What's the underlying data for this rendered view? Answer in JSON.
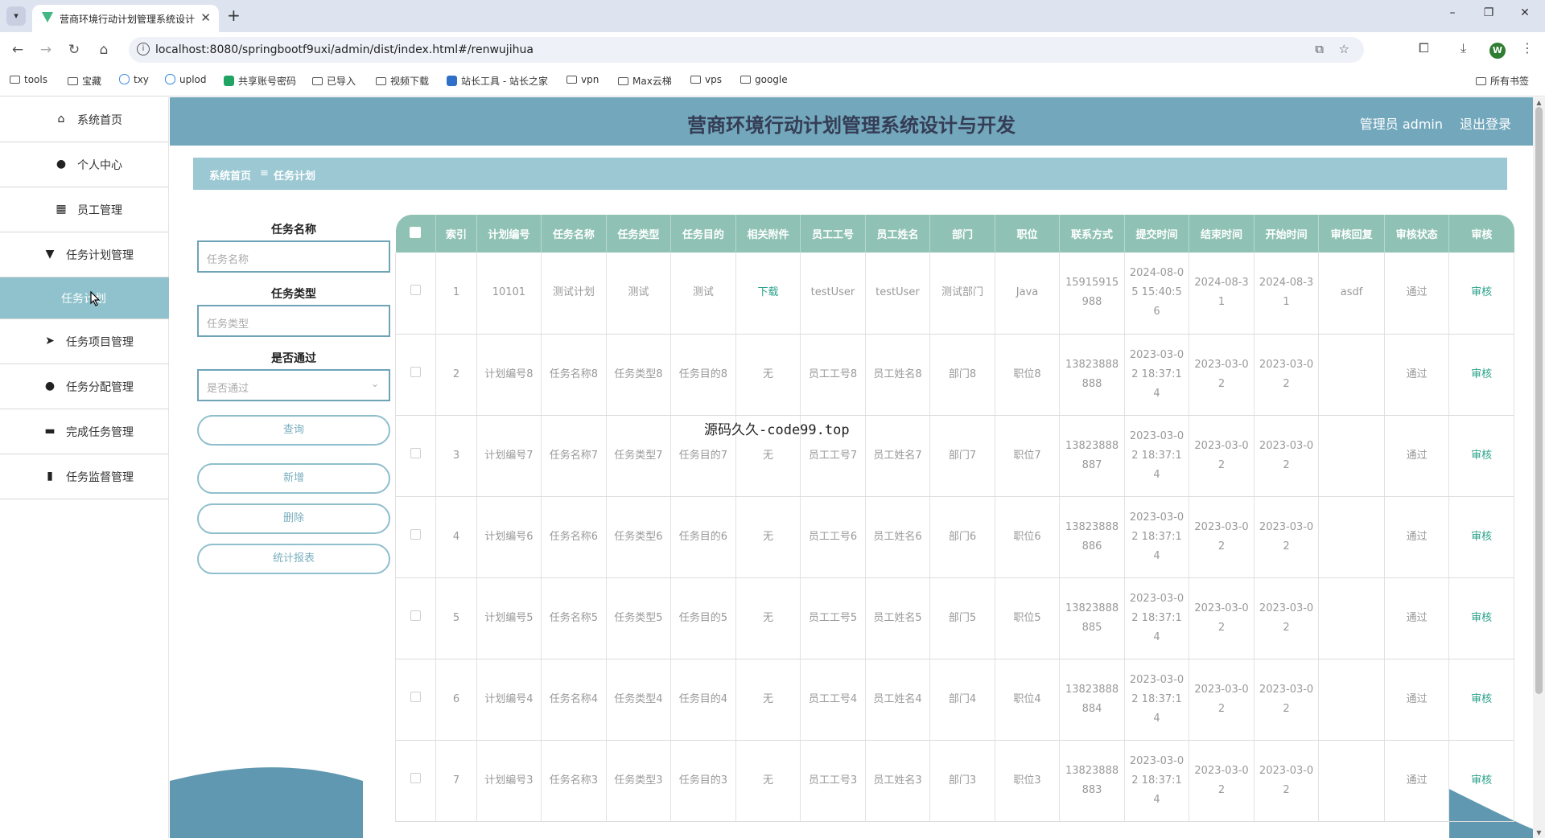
{
  "browser": {
    "tab_title": "营商环境行动计划管理系统设计",
    "url": "localhost:8080/springbootf9uxi/admin/dist/index.html#/renwujihua",
    "profile_initial": "W",
    "bookmarks": [
      "tools",
      "宝藏",
      "txy",
      "uplod",
      "共享账号密码",
      "已导入",
      "视频下载",
      "站长工具 - 站长之家",
      "vpn",
      "Max云梯",
      "vps",
      "google"
    ],
    "all_bookmarks": "所有书签"
  },
  "app": {
    "title": "营商环境行动计划管理系统设计与开发",
    "user_label": "管理员 admin",
    "logout_label": "退出登录"
  },
  "sidebar": {
    "items": [
      {
        "label": "系统首页",
        "icon": "home-icon"
      },
      {
        "label": "个人中心",
        "icon": "user-icon"
      },
      {
        "label": "员工管理",
        "icon": "grid-icon"
      },
      {
        "label": "任务计划管理",
        "icon": "podium-icon"
      },
      {
        "label": "任务计划",
        "icon": ""
      },
      {
        "label": "任务项目管理",
        "icon": "send-icon"
      },
      {
        "label": "任务分配管理",
        "icon": "bulb-icon"
      },
      {
        "label": "完成任务管理",
        "icon": "briefcase-icon"
      },
      {
        "label": "任务监督管理",
        "icon": "bar-chart-icon"
      }
    ]
  },
  "breadcrumb": {
    "home": "系统首页",
    "separator": "≡",
    "current": "任务计划"
  },
  "search": {
    "name_label": "任务名称",
    "name_placeholder": "任务名称",
    "type_label": "任务类型",
    "type_placeholder": "任务类型",
    "pass_label": "是否通过",
    "pass_placeholder": "是否通过",
    "query_button": "查询",
    "add_button": "新增",
    "delete_button": "删除",
    "report_button": "统计报表"
  },
  "table": {
    "columns": [
      "",
      "索引",
      "计划编号",
      "任务名称",
      "任务类型",
      "任务目的",
      "相关附件",
      "员工工号",
      "员工姓名",
      "部门",
      "职位",
      "联系方式",
      "提交时间",
      "结束时间",
      "开始时间",
      "审核回复",
      "审核状态",
      "审核"
    ],
    "rows": [
      {
        "index": "1",
        "plan_no": "10101",
        "name": "测试计划",
        "type": "测试",
        "purpose": "测试",
        "attachment": "下载",
        "emp_no": "testUser",
        "emp_name": "testUser",
        "dept": "测试部门",
        "position": "Java",
        "phone": "15915915988",
        "submit_time": "2024-08-05 15:40:56",
        "end_time": "2024-08-31",
        "start_time": "2024-08-31",
        "reply": "asdf",
        "status": "通过",
        "action": "审核"
      },
      {
        "index": "2",
        "plan_no": "计划编号8",
        "name": "任务名称8",
        "type": "任务类型8",
        "purpose": "任务目的8",
        "attachment": "无",
        "emp_no": "员工工号8",
        "emp_name": "员工姓名8",
        "dept": "部门8",
        "position": "职位8",
        "phone": "13823888888",
        "submit_time": "2023-03-02 18:37:14",
        "end_time": "2023-03-02",
        "start_time": "2023-03-02",
        "reply": "",
        "status": "通过",
        "action": "审核"
      },
      {
        "index": "3",
        "plan_no": "计划编号7",
        "name": "任务名称7",
        "type": "任务类型7",
        "purpose": "任务目的7",
        "attachment": "无",
        "emp_no": "员工工号7",
        "emp_name": "员工姓名7",
        "dept": "部门7",
        "position": "职位7",
        "phone": "13823888887",
        "submit_time": "2023-03-02 18:37:14",
        "end_time": "2023-03-02",
        "start_time": "2023-03-02",
        "reply": "",
        "status": "通过",
        "action": "审核"
      },
      {
        "index": "4",
        "plan_no": "计划编号6",
        "name": "任务名称6",
        "type": "任务类型6",
        "purpose": "任务目的6",
        "attachment": "无",
        "emp_no": "员工工号6",
        "emp_name": "员工姓名6",
        "dept": "部门6",
        "position": "职位6",
        "phone": "13823888886",
        "submit_time": "2023-03-02 18:37:14",
        "end_time": "2023-03-02",
        "start_time": "2023-03-02",
        "reply": "",
        "status": "通过",
        "action": "审核"
      },
      {
        "index": "5",
        "plan_no": "计划编号5",
        "name": "任务名称5",
        "type": "任务类型5",
        "purpose": "任务目的5",
        "attachment": "无",
        "emp_no": "员工工号5",
        "emp_name": "员工姓名5",
        "dept": "部门5",
        "position": "职位5",
        "phone": "13823888885",
        "submit_time": "2023-03-02 18:37:14",
        "end_time": "2023-03-02",
        "start_time": "2023-03-02",
        "reply": "",
        "status": "通过",
        "action": "审核"
      },
      {
        "index": "6",
        "plan_no": "计划编号4",
        "name": "任务名称4",
        "type": "任务类型4",
        "purpose": "任务目的4",
        "attachment": "无",
        "emp_no": "员工工号4",
        "emp_name": "员工姓名4",
        "dept": "部门4",
        "position": "职位4",
        "phone": "13823888884",
        "submit_time": "2023-03-02 18:37:14",
        "end_time": "2023-03-02",
        "start_time": "2023-03-02",
        "reply": "",
        "status": "通过",
        "action": "审核"
      },
      {
        "index": "7",
        "plan_no": "计划编号3",
        "name": "任务名称3",
        "type": "任务类型3",
        "purpose": "任务目的3",
        "attachment": "无",
        "emp_no": "员工工号3",
        "emp_name": "员工姓名3",
        "dept": "部门3",
        "position": "职位3",
        "phone": "13823888883",
        "submit_time": "2023-03-02 18:37:14",
        "end_time": "2023-03-02",
        "start_time": "2023-03-02",
        "reply": "",
        "status": "通过",
        "action": "审核"
      }
    ]
  },
  "watermark": "源码久久-code99.top",
  "colors": {
    "header": "#72a7bc",
    "breadcrumb": "#9bc8d3",
    "table_header": "#8fc2b4",
    "sidebar_active": "#8fc2cc",
    "action_link": "#2aa18a"
  }
}
